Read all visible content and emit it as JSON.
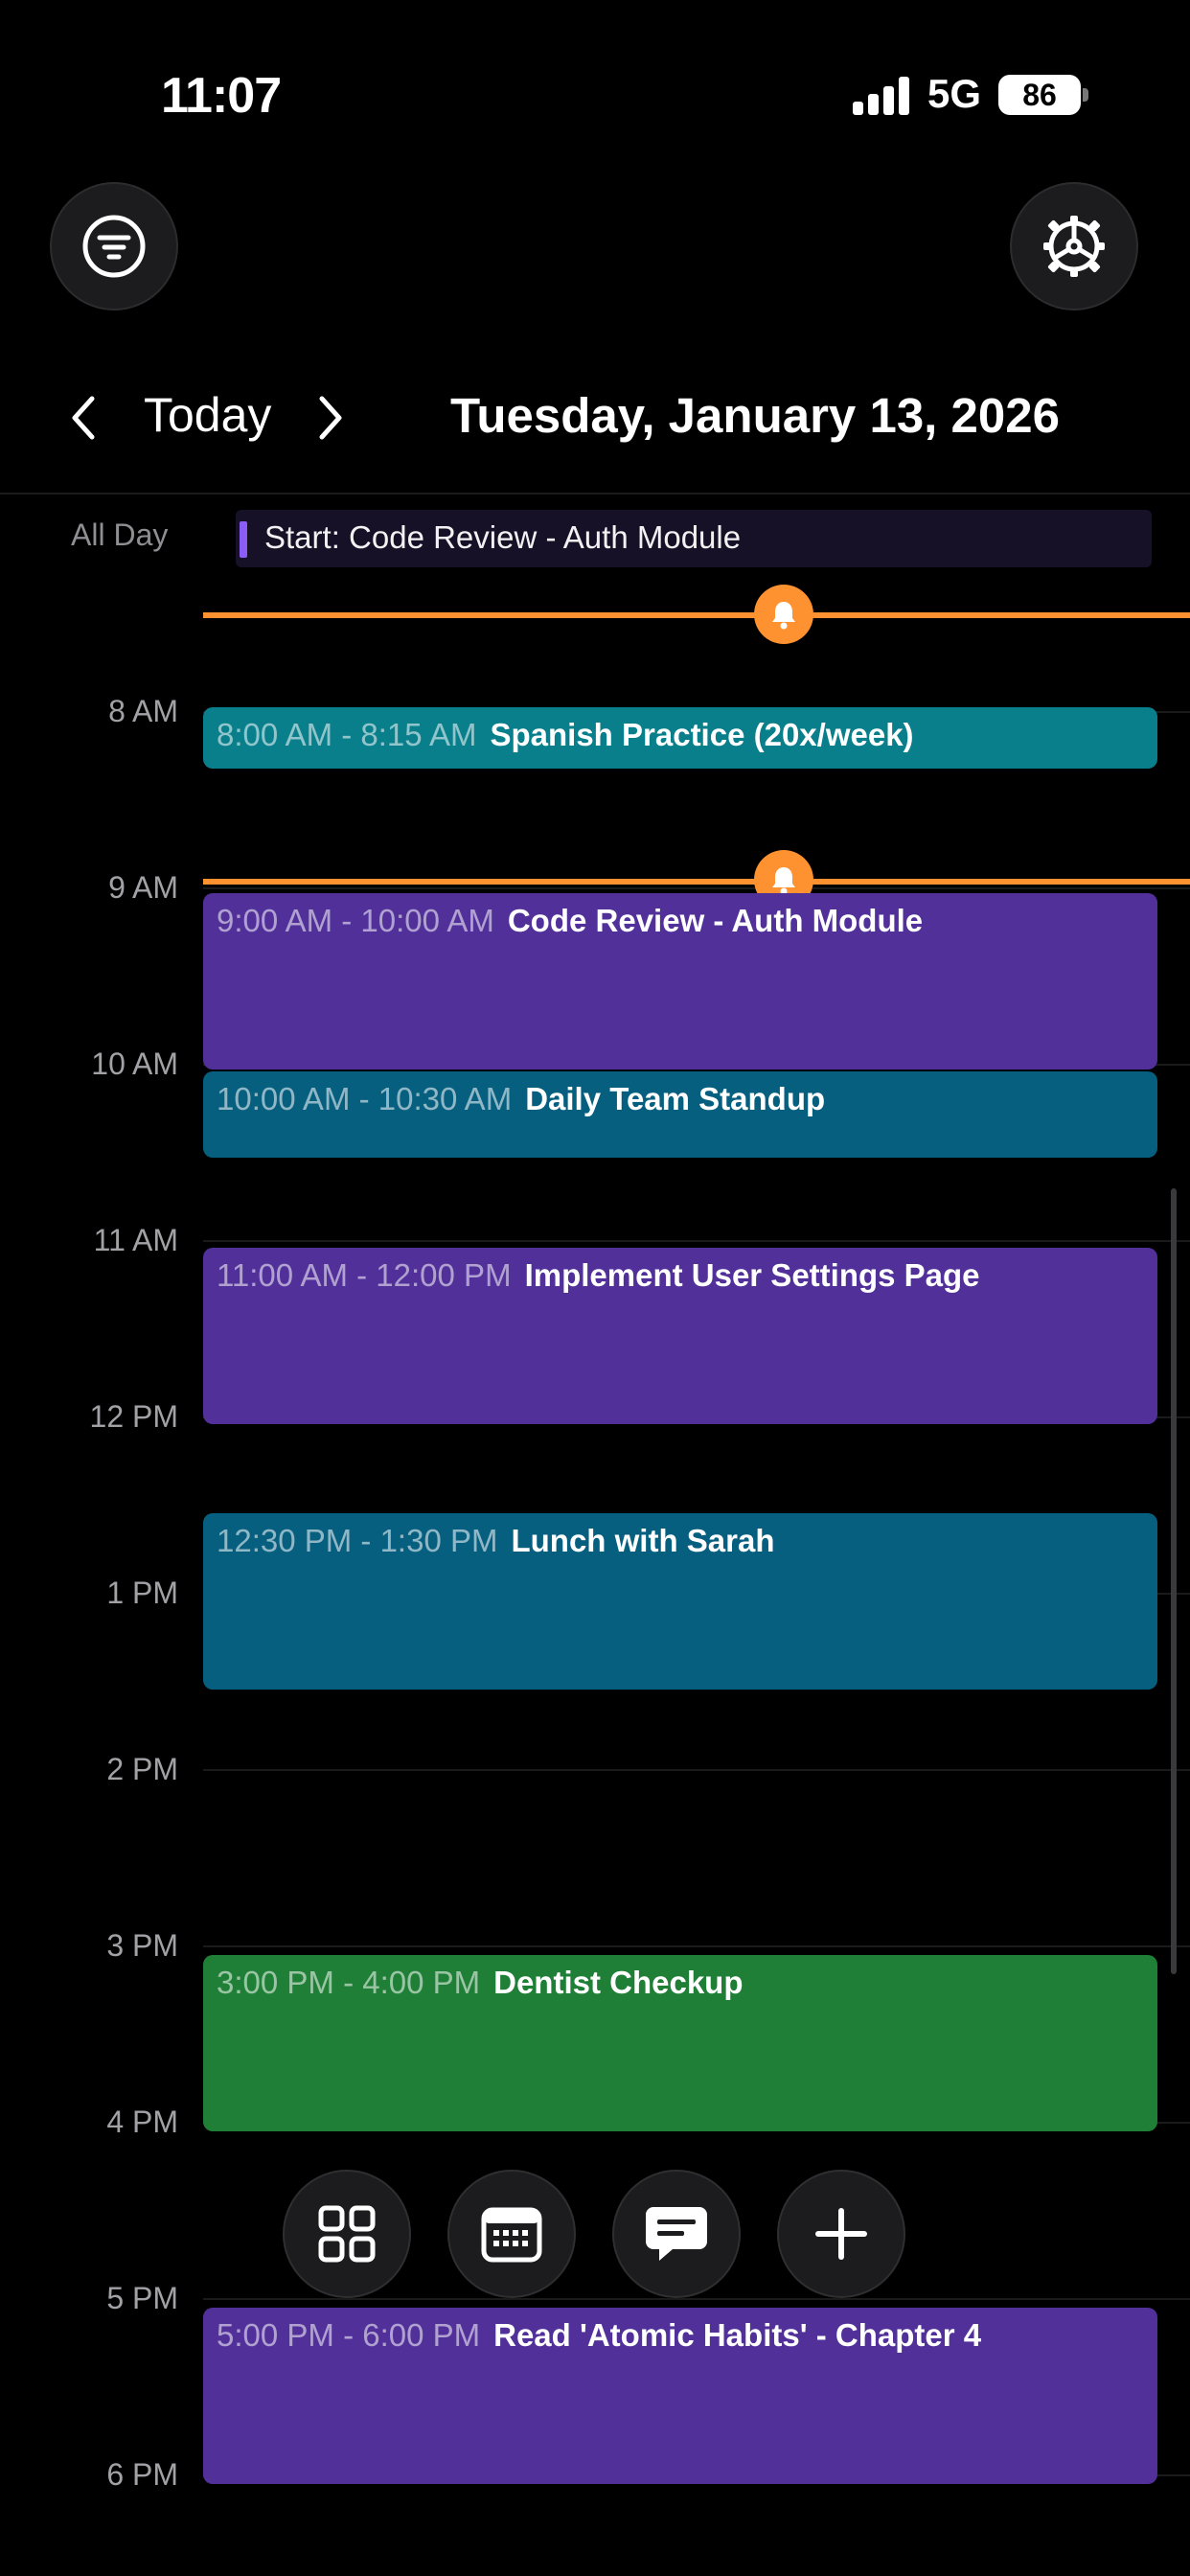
{
  "status_bar": {
    "time": "11:07",
    "network": "5G",
    "battery": "86"
  },
  "nav": {
    "today_label": "Today",
    "date_title": "Tuesday, January 13, 2026"
  },
  "all_day": {
    "label": "All Day",
    "event": "Start: Code Review - Auth Module",
    "accent": "#8b5cf6"
  },
  "hours": [
    "8 AM",
    "9 AM",
    "10 AM",
    "11 AM",
    "12 PM",
    "1 PM",
    "2 PM",
    "3 PM",
    "4 PM",
    "5 PM",
    "6 PM"
  ],
  "events": [
    {
      "time": "8:00 AM - 8:15 AM",
      "title": "Spanish Practice (20x/week)",
      "color": "#0a7f8c"
    },
    {
      "time": "9:00 AM - 10:00 AM",
      "title": "Code Review - Auth Module",
      "color": "#51309a"
    },
    {
      "time": "10:00 AM - 10:30 AM",
      "title": "Daily Team Standup",
      "color": "#075f80"
    },
    {
      "time": "11:00 AM - 12:00 PM",
      "title": "Implement User Settings Page",
      "color": "#51309a"
    },
    {
      "time": "12:30 PM - 1:30 PM",
      "title": "Lunch with Sarah",
      "color": "#075f80"
    },
    {
      "time": "3:00 PM - 4:00 PM",
      "title": "Dentist Checkup",
      "color": "#207f37"
    },
    {
      "time": "5:00 PM - 6:00 PM",
      "title": "Read 'Atomic Habits' - Chapter 4",
      "color": "#51309a"
    }
  ],
  "colors": {
    "now_line": "#ff9230",
    "background": "#000000"
  },
  "icons": {
    "filter": "filter-icon",
    "settings": "gear-icon",
    "prev": "chevron-left-icon",
    "next": "chevron-right-icon",
    "bell": "bell-icon",
    "grid": "grid-icon",
    "calendar": "calendar-icon",
    "chat": "chat-icon",
    "add": "plus-icon"
  }
}
